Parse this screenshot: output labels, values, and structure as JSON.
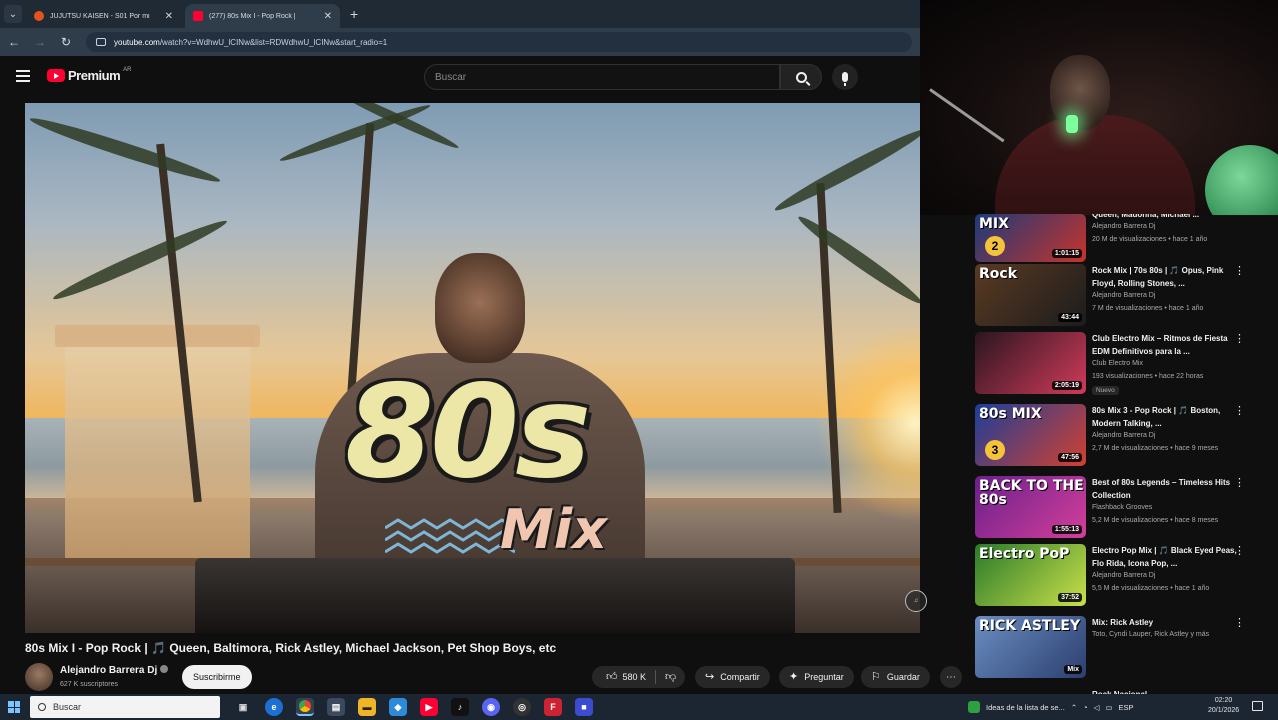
{
  "browser": {
    "tabs": [
      {
        "title": "JUJUTSU KAISEN - S01 Por mi",
        "active": false,
        "favicon": "crunchyroll-icon",
        "color": "#e2541c"
      },
      {
        "title": "(277) 80s Mix I - Pop Rock |",
        "active": true,
        "favicon": "youtube-icon",
        "color": "#ff0033"
      }
    ],
    "url_host": "youtube.com",
    "url_path": "/watch?v=WdhwU_lCINw&list=RDWdhwU_lCINw&start_radio=1"
  },
  "header": {
    "logo_word": "Premium",
    "logo_country": "AR",
    "search_placeholder": "Buscar"
  },
  "video": {
    "overlay_big": "80s",
    "overlay_small": "Mix",
    "title": "80s Mix I - Pop Rock | 🎵 Queen, Baltimora, Rick Astley, Michael Jackson, Pet Shop Boys, etc",
    "channel_name": "Alejandro Barrera Dj",
    "subscribers": "627 K suscriptores",
    "subscribe_label": "Suscribirme",
    "likes": "580 K",
    "share_label": "Compartir",
    "ask_label": "Preguntar",
    "save_label": "Guardar"
  },
  "recommendations": [
    {
      "thumb_text": "MIX",
      "thumb_num": "2",
      "duration": "1:01:15",
      "title": "Queen, Madonna, Michael ...",
      "channel": "Alejandro Barrera Dj",
      "meta": "20 M de visualizaciones • hace 1 año",
      "colors": [
        "#1b3a7a",
        "#c8332b"
      ],
      "new": ""
    },
    {
      "thumb_text": "Rock",
      "thumb_num": "",
      "duration": "43:44",
      "title": "Rock Mix | 70s 80s | 🎵 Opus, Pink Floyd, Rolling Stones, ...",
      "channel": "Alejandro Barrera Dj",
      "meta": "7 M de visualizaciones • hace 1 año",
      "colors": [
        "#5a3a22",
        "#1c1c1c"
      ],
      "new": ""
    },
    {
      "thumb_text": "",
      "thumb_num": "",
      "duration": "2:05:19",
      "title": "Club Electro Mix – Ritmos de Fiesta EDM Definitivos para la ...",
      "channel": "Club Electro Mix",
      "meta": "193 visualizaciones • hace 22 horas",
      "colors": [
        "#2a1620",
        "#d13a5a"
      ],
      "new": "Nuevo"
    },
    {
      "thumb_text": "80s MIX",
      "thumb_num": "3",
      "duration": "47:56",
      "title": "80s Mix 3 - Pop Rock | 🎵 Boston, Modern Talking, ...",
      "channel": "Alejandro Barrera Dj",
      "meta": "2,7 M de visualizaciones • hace 9 meses",
      "colors": [
        "#1c3e9a",
        "#d2402f"
      ],
      "new": ""
    },
    {
      "thumb_text": "BACK TO THE 80s",
      "thumb_num": "",
      "duration": "1:55:13",
      "title": "Best of 80s Legends – Timeless Hits Collection",
      "channel": "Flashback Grooves",
      "meta": "5,2 M de visualizaciones • hace 8 meses",
      "colors": [
        "#6a1f8c",
        "#d43f9a"
      ],
      "new": ""
    },
    {
      "thumb_text": "Electro PoP",
      "thumb_num": "",
      "duration": "37:52",
      "title": "Electro Pop Mix | 🎵 Black Eyed Peas, Flo Rida, Icona Pop, ...",
      "channel": "Alejandro Barrera Dj",
      "meta": "5,5 M de visualizaciones • hace 1 año",
      "colors": [
        "#2a7a2a",
        "#c9e04a"
      ],
      "new": ""
    },
    {
      "thumb_text": "RICK ASTLEY",
      "thumb_num": "",
      "duration": "Mix",
      "title": "Mix: Rick Astley",
      "channel": "Toto, Cyndi Lauper, Rick Astley y más",
      "meta": "",
      "colors": [
        "#6b8dc2",
        "#2b3f6e"
      ],
      "new": ""
    }
  ],
  "rec_partial_title": "Rock Nacional",
  "taskbar": {
    "search_placeholder": "Buscar",
    "tray_text": "Ideas de la lista de se...",
    "lang": "ESP",
    "time": "02:20",
    "date": "20/1/2026"
  }
}
